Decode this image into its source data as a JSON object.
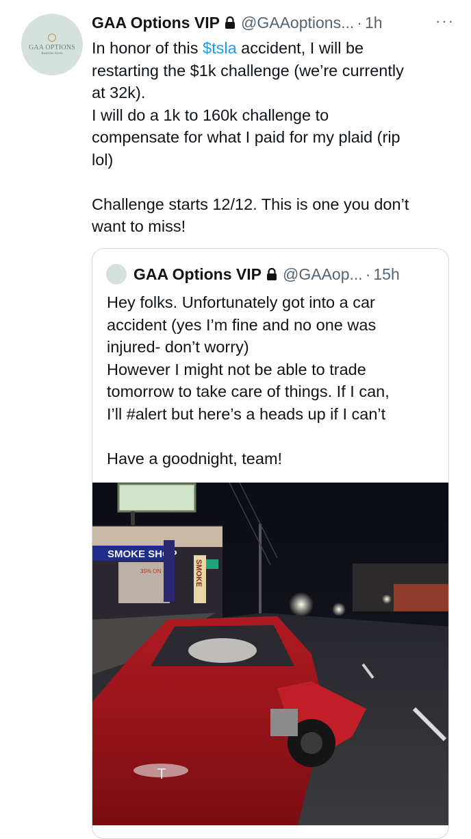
{
  "tweet": {
    "avatar_brand": "GAA OPTIONS",
    "avatar_tagline": "Realtime Alerts",
    "display_name": "GAA Options VIP",
    "handle": "@GAAoptions...",
    "separator": "·",
    "time": "1h",
    "more_label": "···",
    "lines": [
      [
        "In honor of this ",
        "$tsla",
        " accident, I will be"
      ],
      "restarting the $1k challenge (we’re currently",
      "at 32k).",
      "I will do a 1k to 160k challenge to",
      "compensate for what I paid for my plaid (rip",
      "lol)",
      "",
      "Challenge starts 12/12. This is one you don’t",
      "want to miss!"
    ]
  },
  "quote": {
    "display_name": "GAA Options VIP",
    "handle": "@GAAop...",
    "separator": "·",
    "time": "15h",
    "lines": [
      "Hey folks. Unfortunately got into a car",
      "accident (yes I’m fine and no one was",
      "injured- don’t worry)",
      "However I might not be able to trade",
      "tomorrow to take care of things. If I can,",
      "I’ll #alert but here’s a heads up if I can’t",
      "",
      "Have a goodnight, team!"
    ],
    "photo": {
      "smoke_shop_sign": "SMOKE SHOP",
      "vertical_sign": "SMOKE",
      "sale_sign": "35% ON",
      "accent": "#c8222a"
    }
  },
  "colors": {
    "link": "#1d9bf0",
    "secondary": "#536471",
    "border": "#cfd9de"
  }
}
